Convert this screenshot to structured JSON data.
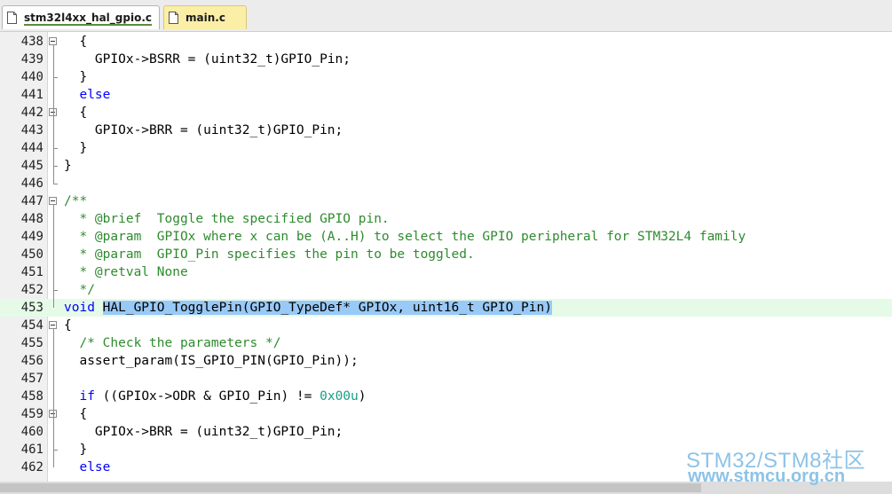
{
  "tabs": [
    {
      "label": "stm32l4xx_hal_gpio.c",
      "active": true
    },
    {
      "label": "main.c",
      "active": false
    }
  ],
  "editor": {
    "lines": [
      {
        "num": "438",
        "segs": [
          {
            "t": "  {"
          }
        ]
      },
      {
        "num": "439",
        "segs": [
          {
            "t": "    GPIOx->BSRR = (uint32_t)GPIO_Pin;"
          }
        ]
      },
      {
        "num": "440",
        "segs": [
          {
            "t": "  }"
          }
        ]
      },
      {
        "num": "441",
        "segs": [
          {
            "t": "  "
          },
          {
            "t": "else",
            "c": "kw"
          }
        ]
      },
      {
        "num": "442",
        "segs": [
          {
            "t": "  {"
          }
        ]
      },
      {
        "num": "443",
        "segs": [
          {
            "t": "    GPIOx->BRR = (uint32_t)GPIO_Pin;"
          }
        ]
      },
      {
        "num": "444",
        "segs": [
          {
            "t": "  }"
          }
        ]
      },
      {
        "num": "445",
        "segs": [
          {
            "t": "}"
          }
        ]
      },
      {
        "num": "446",
        "segs": []
      },
      {
        "num": "447",
        "segs": [
          {
            "t": "/**",
            "c": "cm"
          }
        ]
      },
      {
        "num": "448",
        "segs": [
          {
            "t": "  * @brief  Toggle the specified GPIO pin.",
            "c": "cm"
          }
        ]
      },
      {
        "num": "449",
        "segs": [
          {
            "t": "  * @param  GPIOx where x can be (A..H) to select the GPIO peripheral for STM32L4 family",
            "c": "cm"
          }
        ]
      },
      {
        "num": "450",
        "segs": [
          {
            "t": "  * @param  GPIO_Pin specifies the pin to be toggled.",
            "c": "cm"
          }
        ]
      },
      {
        "num": "451",
        "segs": [
          {
            "t": "  * @retval None",
            "c": "cm"
          }
        ]
      },
      {
        "num": "452",
        "segs": [
          {
            "t": "  */",
            "c": "cm"
          }
        ]
      },
      {
        "num": "453",
        "segs": [
          {
            "t": "void",
            "c": "kw"
          },
          {
            "t": " "
          },
          {
            "t": "HAL_GPIO_TogglePin(GPIO_TypeDef* GPIOx, uint16_t GPIO_Pin)",
            "c": "sel"
          }
        ]
      },
      {
        "num": "454",
        "segs": [
          {
            "t": "{"
          }
        ]
      },
      {
        "num": "455",
        "segs": [
          {
            "t": "  "
          },
          {
            "t": "/* Check the parameters */",
            "c": "cm"
          }
        ]
      },
      {
        "num": "456",
        "segs": [
          {
            "t": "  assert_param(IS_GPIO_PIN(GPIO_Pin));"
          }
        ]
      },
      {
        "num": "457",
        "segs": []
      },
      {
        "num": "458",
        "segs": [
          {
            "t": "  "
          },
          {
            "t": "if",
            "c": "kw"
          },
          {
            "t": " ((GPIOx->ODR & GPIO_Pin) != "
          },
          {
            "t": "0x00u",
            "c": "nm"
          },
          {
            "t": ")"
          }
        ]
      },
      {
        "num": "459",
        "segs": [
          {
            "t": "  {"
          }
        ]
      },
      {
        "num": "460",
        "segs": [
          {
            "t": "    GPIOx->BRR = (uint32_t)GPIO_Pin;"
          }
        ]
      },
      {
        "num": "461",
        "segs": [
          {
            "t": "  }"
          }
        ]
      },
      {
        "num": "462",
        "segs": [
          {
            "t": "  "
          },
          {
            "t": "else",
            "c": "kw"
          }
        ]
      }
    ],
    "current_line": "453",
    "fold_markers": [
      "438",
      "442",
      "447",
      "454",
      "459"
    ]
  },
  "watermark": {
    "line1": "STM32/STM8社区",
    "line2": "www.stmcu.org.cn"
  }
}
